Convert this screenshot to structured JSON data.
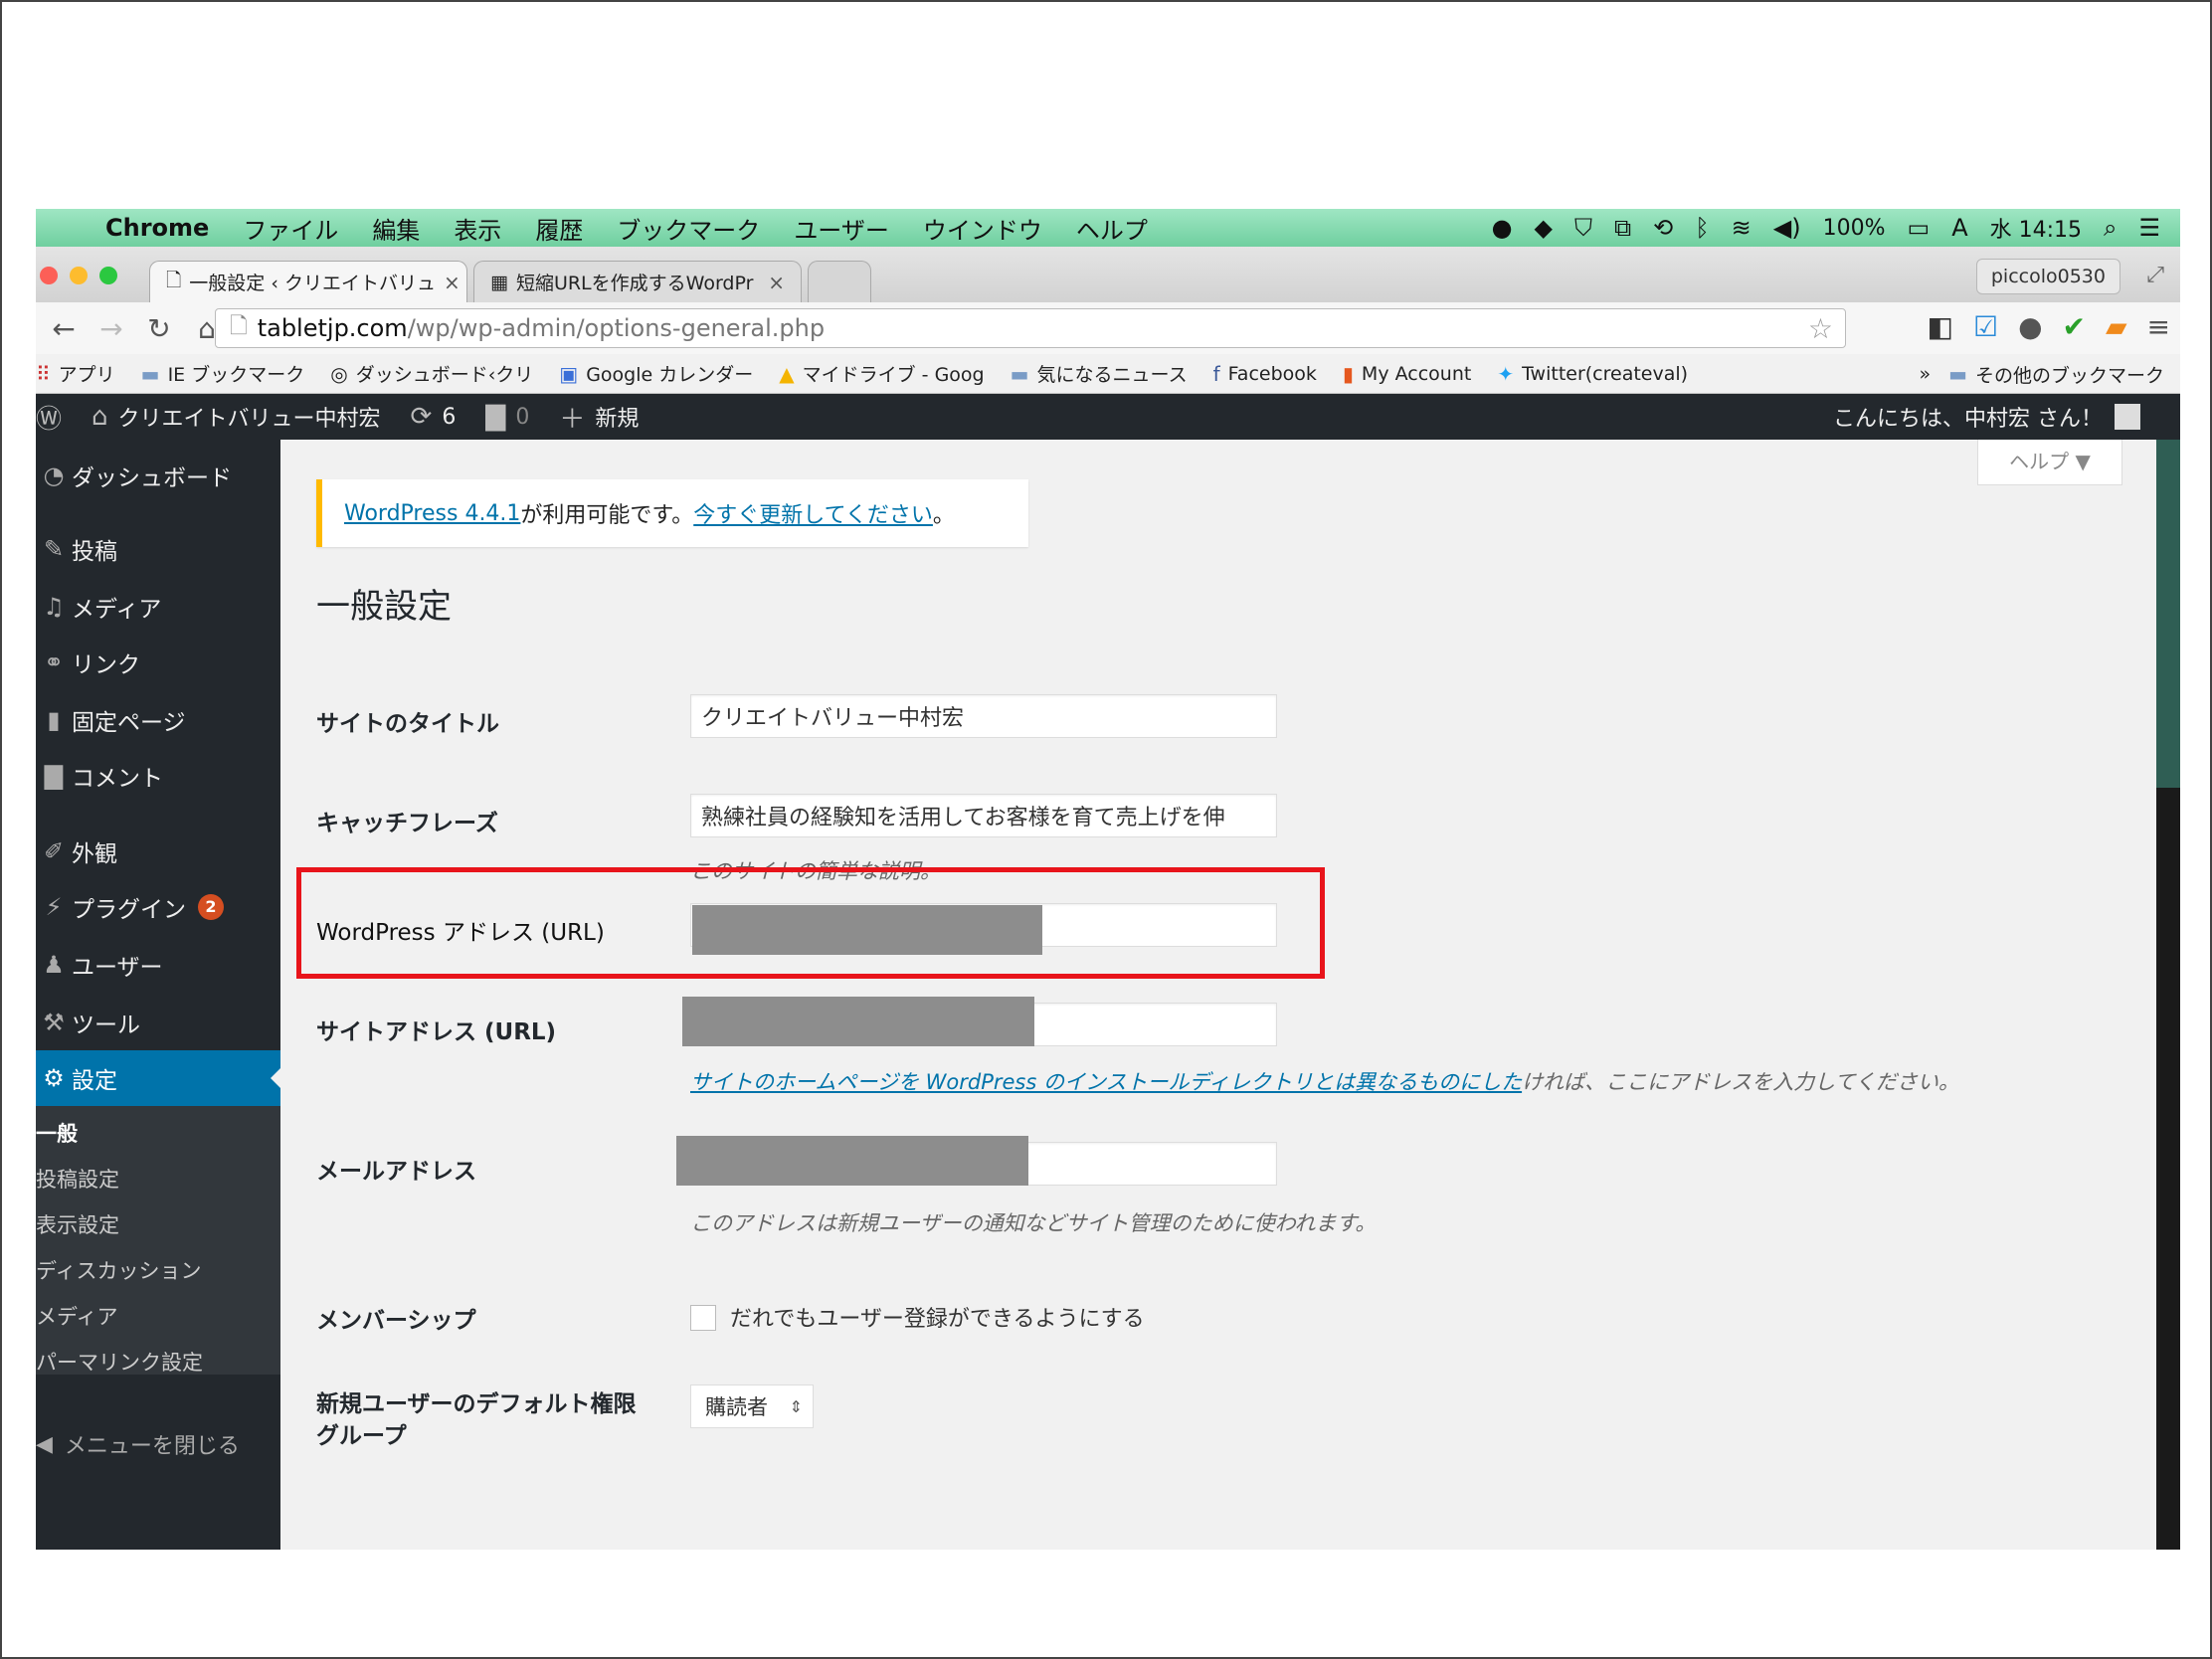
{
  "menubar": {
    "app": "Chrome",
    "items": [
      "ファイル",
      "編集",
      "表示",
      "履歴",
      "ブックマーク",
      "ユーザー",
      "ウインドウ",
      "ヘルプ"
    ],
    "battery": "100%",
    "clock": "水 14:15"
  },
  "tabs": [
    {
      "label": "一般設定 ‹ クリエイトバリュ",
      "active": true
    },
    {
      "label": "短縮URLを作成するWordPr",
      "active": false
    }
  ],
  "profile": "piccolo0530",
  "address": {
    "host": "tabletjp.com",
    "path": "/wp/wp-admin/options-general.php"
  },
  "bookmarks": {
    "items": [
      "アプリ",
      "IE ブックマーク",
      "ダッシュボード‹クリ",
      "Google カレンダー",
      "マイドライブ - Goog",
      "気になるニュース",
      "Facebook",
      "My Account",
      "Twitter(createval)"
    ],
    "more": "»",
    "other": "その他のブックマーク"
  },
  "adminbar": {
    "site": "クリエイトバリュー中村宏",
    "updates": "6",
    "comments": "0",
    "new_label": "新規",
    "greeting": "こんにちは、中村宏 さん！"
  },
  "sidebar": {
    "dashboard": "ダッシュボード",
    "posts": "投稿",
    "media": "メディア",
    "links": "リンク",
    "pages": "固定ページ",
    "comments": "コメント",
    "appearance": "外観",
    "plugins": "プラグイン",
    "plugins_badge": "2",
    "users": "ユーザー",
    "tools": "ツール",
    "settings": "設定",
    "submenu": [
      "一般",
      "投稿設定",
      "表示設定",
      "ディスカッション",
      "メディア",
      "パーマリンク設定"
    ],
    "collapse": "メニューを閉じる"
  },
  "help_tab": "ヘルプ ▼",
  "notice": {
    "version_link": "WordPress 4.4.1",
    "text": " が利用可能です。",
    "update_link": "今すぐ更新してください",
    "end": "。"
  },
  "page_title": "一般設定",
  "fields": {
    "site_title_label": "サイトのタイトル",
    "site_title_value": "クリエイトバリュー中村宏",
    "tagline_label": "キャッチフレーズ",
    "tagline_value": "熟練社員の経験知を活用してお客様を育て売上げを伸",
    "tagline_desc": "このサイトの簡単な説明。",
    "wp_address_label": "WordPress アドレス (URL)",
    "site_address_label": "サイトアドレス (URL)",
    "site_address_desc_link": "サイトのホームページを WordPress のインストールディレクトリとは異なるものにした",
    "site_address_desc_text": "ければ、ここにアドレスを入力してください。",
    "email_label": "メールアドレス",
    "email_desc": "このアドレスは新規ユーザーの通知などサイト管理のために使われます。",
    "membership_label": "メンバーシップ",
    "membership_checkbox": "だれでもユーザー登録ができるようにする",
    "default_role_label_1": "新規ユーザーのデフォルト権限",
    "default_role_label_2": "グループ",
    "default_role_value": "購読者"
  }
}
